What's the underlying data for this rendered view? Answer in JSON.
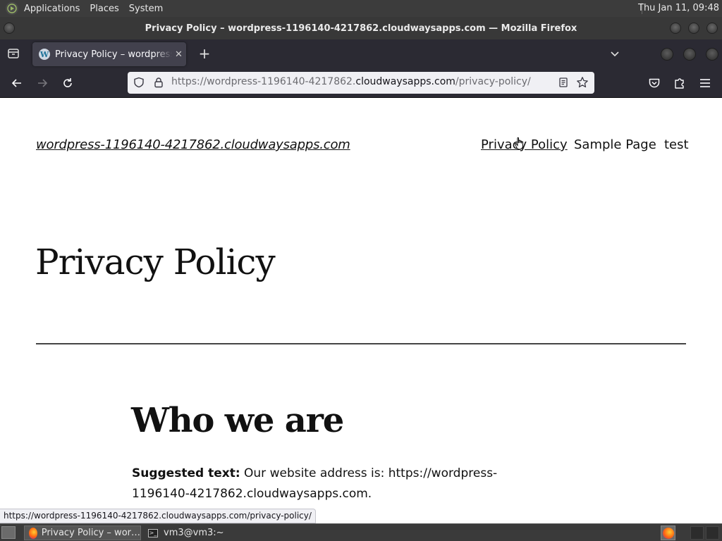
{
  "top_panel": {
    "menus": [
      "Applications",
      "Places",
      "System"
    ],
    "clock": "Thu Jan 11, 09:48"
  },
  "window": {
    "title": "Privacy Policy – wordpress-1196140-4217862.cloudwaysapps.com — Mozilla Firefox"
  },
  "tabs": [
    {
      "label": "Privacy Policy – wordpress-1196140-4217862.cloudwaysapps.com",
      "icon": "wordpress-favicon",
      "close": "✕"
    }
  ],
  "new_tab_label": "+",
  "urlbar": {
    "prefix": "https://wordpress-1196140-4217862.",
    "host": "cloudwaysapps.com",
    "path": "/privacy-policy/"
  },
  "site": {
    "title": "wordpress-1196140-4217862.cloudwaysapps.com",
    "nav": [
      "Privacy Policy",
      "Sample Page",
      "test"
    ],
    "page_title": "Privacy Policy",
    "section_heading": "Who we are",
    "para_bold": "Suggested text:",
    "para_text": " Our website address is: https://wordpress-1196140-4217862.cloudwaysapps.com."
  },
  "status_url": "https://wordpress-1196140-4217862.cloudwaysapps.com/privacy-policy/",
  "taskbar": {
    "tasks": [
      "Privacy Policy – wor…",
      "vm3@vm3:~"
    ]
  },
  "colors": {
    "toolbar": "#2b2a33",
    "tab_active": "#42414d",
    "urlbar_bg": "#f0f0f4",
    "page_bg": "#ffffff"
  }
}
